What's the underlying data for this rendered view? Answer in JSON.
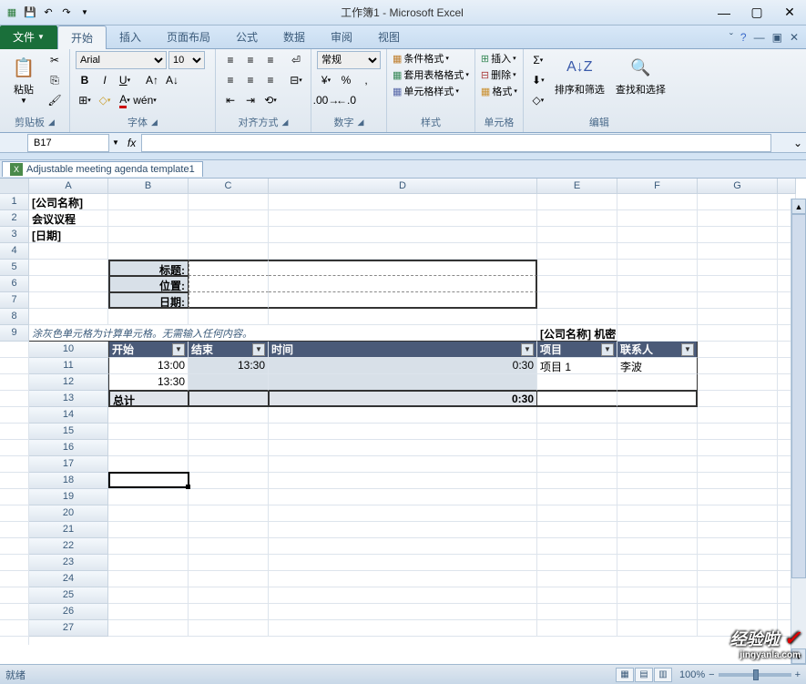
{
  "title": "工作簿1 - Microsoft Excel",
  "tabs": {
    "file": "文件",
    "home": "开始",
    "insert": "插入",
    "layout": "页面布局",
    "formula": "公式",
    "data": "数据",
    "review": "审阅",
    "view": "视图"
  },
  "ribbon": {
    "clipboard": {
      "label": "剪贴板",
      "paste": "粘贴"
    },
    "font": {
      "label": "字体",
      "name": "Arial",
      "size": "10"
    },
    "align": {
      "label": "对齐方式"
    },
    "number": {
      "label": "数字",
      "format": "常规"
    },
    "styles": {
      "label": "样式",
      "cond": "条件格式",
      "table": "套用表格格式",
      "cell": "单元格样式"
    },
    "cells": {
      "label": "单元格",
      "insert": "插入",
      "delete": "删除",
      "format": "格式"
    },
    "editing": {
      "label": "编辑",
      "sort": "排序和筛选",
      "find": "查找和选择"
    }
  },
  "namebox": "B17",
  "fx_label": "fx",
  "sheet_tab": "Adjustable meeting agenda template1",
  "cols": [
    "A",
    "B",
    "C",
    "D",
    "E",
    "F",
    "G"
  ],
  "rows": [
    "1",
    "2",
    "3",
    "4",
    "5",
    "6",
    "7",
    "8",
    "9",
    "10",
    "11",
    "12",
    "13",
    "14",
    "15",
    "16",
    "17",
    "18",
    "19",
    "20",
    "21",
    "22",
    "23",
    "24",
    "25",
    "26",
    "27"
  ],
  "a1": "[公司名称]",
  "a2": "会议议程",
  "a3": "[日期]",
  "hdr": {
    "title": "标题:",
    "loc": "位置:",
    "date": "日期:"
  },
  "note": "涂灰色单元格为计算单元格。无需输入任何内容。",
  "confidential": "[公司名称] 机密",
  "thdrs": {
    "start": "开始",
    "end": "结束",
    "time": "时间",
    "item": "项目",
    "contact": "联系人"
  },
  "row11": {
    "start": "13:00",
    "end": "13:30",
    "time": "0:30",
    "item": "项目 1",
    "contact": "李波"
  },
  "row12": {
    "start": "13:30"
  },
  "total": {
    "label": "总计",
    "time": "0:30"
  },
  "status": {
    "ready": "就绪",
    "zoom": "100%"
  },
  "watermark": "经验啦"
}
